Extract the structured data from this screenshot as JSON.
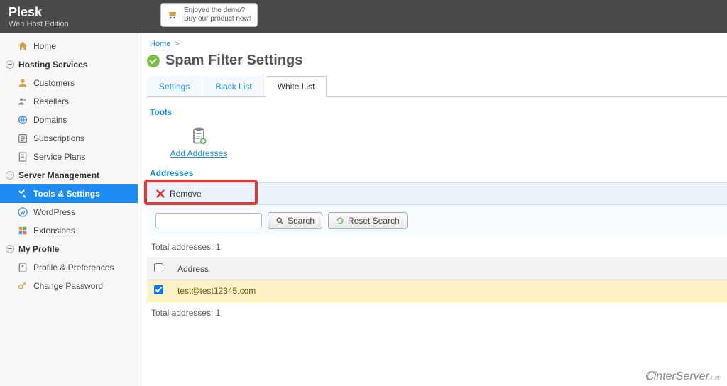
{
  "brand": {
    "title": "Plesk",
    "subtitle": "Web Host Edition"
  },
  "promo": {
    "line1": "Enjoyed the demo?",
    "line2": "Buy our product now!"
  },
  "sidebar": {
    "home": "Home",
    "groups": [
      {
        "label": "Hosting Services",
        "items": [
          {
            "label": "Customers",
            "icon": "user-icon"
          },
          {
            "label": "Resellers",
            "icon": "users-icon"
          },
          {
            "label": "Domains",
            "icon": "globe-icon"
          },
          {
            "label": "Subscriptions",
            "icon": "list-icon"
          },
          {
            "label": "Service Plans",
            "icon": "doc-icon"
          }
        ]
      },
      {
        "label": "Server Management",
        "items": [
          {
            "label": "Tools & Settings",
            "icon": "tools-icon",
            "active": true
          },
          {
            "label": "WordPress",
            "icon": "wordpress-icon"
          },
          {
            "label": "Extensions",
            "icon": "extensions-icon"
          }
        ]
      },
      {
        "label": "My Profile",
        "items": [
          {
            "label": "Profile & Preferences",
            "icon": "profile-icon"
          },
          {
            "label": "Change Password",
            "icon": "key-icon"
          }
        ]
      }
    ]
  },
  "breadcrumb": {
    "home": "Home"
  },
  "page": {
    "title": "Spam Filter Settings"
  },
  "tabs": [
    {
      "label": "Settings"
    },
    {
      "label": "Black List"
    },
    {
      "label": "White List",
      "active": true
    }
  ],
  "sections": {
    "tools": "Tools",
    "addresses": "Addresses"
  },
  "tools": {
    "add_addresses": "Add Addresses"
  },
  "actions": {
    "remove": "Remove",
    "search": "Search",
    "reset_search": "Reset Search"
  },
  "table": {
    "total_label": "Total addresses: 1",
    "col_address": "Address",
    "rows": [
      {
        "address": "test@test12345.com",
        "checked": true
      }
    ]
  },
  "footer": {
    "brand": "interServer",
    "suffix": ".net"
  }
}
